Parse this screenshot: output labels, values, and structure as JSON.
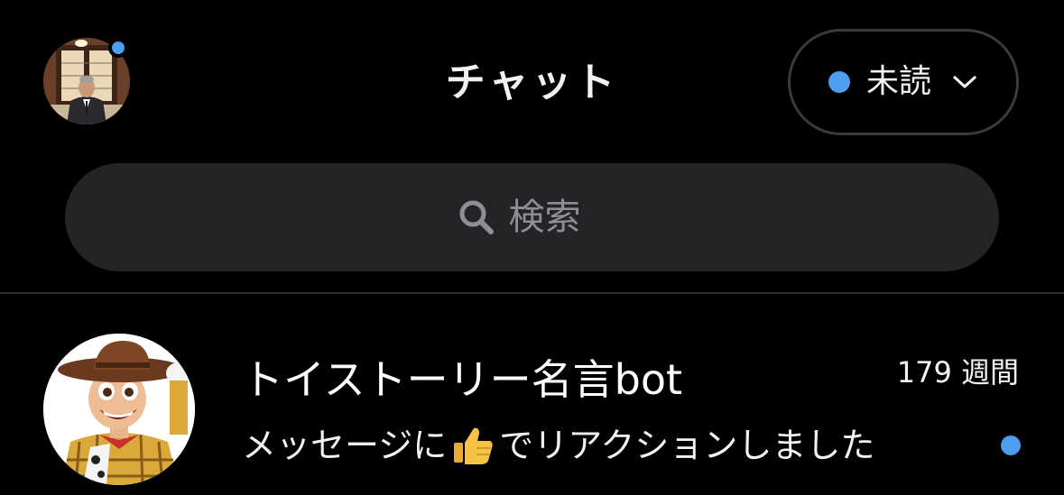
{
  "header": {
    "title": "チャット",
    "filter": {
      "label": "未読",
      "dot_color": "#4d9df0",
      "chevron_icon": "chevron-down-icon"
    },
    "profile": {
      "avatar_icon": "profile-avatar",
      "status_dot_color": "#4d9df0"
    }
  },
  "search": {
    "icon": "search-icon",
    "placeholder": "検索",
    "value": ""
  },
  "chats": [
    {
      "name": "トイストーリー名言bot",
      "time": "179 週間",
      "preview_before": "メッセージに",
      "preview_icon": "thumbs-up-icon",
      "preview_after": "でリアクションしました",
      "unread": true,
      "unread_color": "#4d9df0"
    }
  ]
}
